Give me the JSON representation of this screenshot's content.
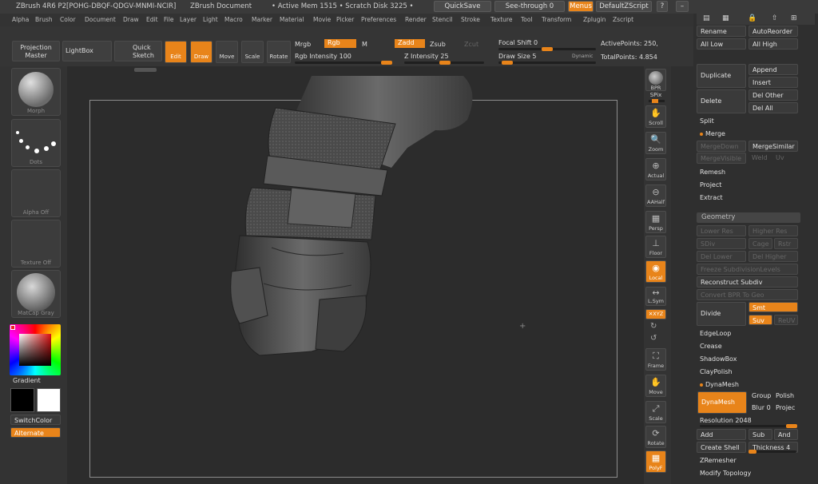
{
  "titlebar": {
    "app": "ZBrush 4R6 P2[POHG-DBQF-QDGV-MNMI-NCIR]",
    "doc": "ZBrush Document",
    "mem": "• Active Mem 1515 • Scratch Disk 3225 •",
    "quicksave": "QuickSave",
    "seethrough": "See-through  0",
    "menus": "Menus",
    "script": "DefaultZScript"
  },
  "menubar": [
    "Alpha",
    "Brush",
    "Color",
    "Document",
    "Draw",
    "Edit",
    "File",
    "Layer",
    "Light",
    "Macro",
    "Marker",
    "Material",
    "Movie",
    "Picker",
    "Preferences",
    "Render",
    "Stencil",
    "Stroke",
    "Texture",
    "Tool",
    "Transform",
    "Zplugin",
    "Zscript"
  ],
  "toolbar": {
    "projection_master": "Projection Master",
    "lightbox": "LightBox",
    "quick_sketch": "Quick Sketch",
    "edit": "Edit",
    "draw": "Draw",
    "move": "Move",
    "scale": "Scale",
    "rotate": "Rotate",
    "mrgb": "Mrgb",
    "rgb": "Rgb",
    "m": "M",
    "rgb_intensity": "Rgb Intensity 100",
    "zadd": "Zadd",
    "zsub": "Zsub",
    "zcut": "Zcut",
    "z_intensity": "Z Intensity 25",
    "focal_shift": "Focal Shift 0",
    "draw_size": "Draw Size 5",
    "dynamic": "Dynamic",
    "active_points": "ActivePoints: 250,",
    "total_points": "TotalPoints: 4.854"
  },
  "leftshelf": {
    "brush": "Morph",
    "stroke": "Dots",
    "alpha": "Alpha Off",
    "texture": "Texture Off",
    "material": "MatCap Gray",
    "gradient": "Gradient",
    "switchcolor": "SwitchColor",
    "alternate": "Alternate"
  },
  "rightshelf": {
    "bpr": "BPR",
    "spix": "SPix",
    "scroll": "Scroll",
    "zoom": "Zoom",
    "actual": "Actual",
    "aahalf": "AAHalf",
    "persp": "Persp",
    "floor": "Floor",
    "local": "Local",
    "lsym": "L.Sym",
    "xyz": "✕XYZ",
    "frame": "Frame",
    "move": "Move",
    "scale": "Scale",
    "rotate": "Rotate",
    "polyf": "PolyF"
  },
  "subtool": {
    "rename": "Rename",
    "autoreorder": "AutoReorder",
    "all_low": "All Low",
    "all_high": "All High",
    "duplicate": "Duplicate",
    "append": "Append",
    "insert": "Insert",
    "delete": "Delete",
    "del_other": "Del Other",
    "del_all": "Del All",
    "split": "Split",
    "merge": "Merge",
    "mergedown": "MergeDown",
    "mergesimilar": "MergeSimilar",
    "mergevisible": "MergeVisible",
    "weld": "Weld",
    "uv": "Uv",
    "remesh": "Remesh",
    "project": "Project",
    "extract": "Extract"
  },
  "geometry": {
    "header": "Geometry",
    "lower_res": "Lower Res",
    "higher_res": "Higher Res",
    "sdiv": "SDiv",
    "cage": "Cage",
    "rstr": "Rstr",
    "del_lower": "Del Lower",
    "del_higher": "Del Higher",
    "freeze": "Freeze SubdivisionLevels",
    "reconstruct": "Reconstruct Subdiv",
    "convert_bpr": "Convert BPR To Geo",
    "divide": "Divide",
    "smt": "Smt",
    "suv": "Suv",
    "reuv": "ReUV",
    "edgeloop": "EdgeLoop",
    "crease": "Crease",
    "shadowbox": "ShadowBox",
    "claypolish": "ClayPolish",
    "dynamesh_section": "DynaMesh",
    "dynamesh_btn": "DynaMesh",
    "group": "Group",
    "polish": "Polish",
    "blur": "Blur 0",
    "projec": "Projec",
    "resolution": "Resolution 2048",
    "add": "Add",
    "sub": "Sub",
    "and": "And",
    "create_shell": "Create Shell",
    "thickness": "Thickness 4",
    "zremesher": "ZRemesher",
    "modify_topology": "Modify Topology"
  },
  "colors": {
    "accent": "#e8841a",
    "bg": "#2b2b2b"
  }
}
